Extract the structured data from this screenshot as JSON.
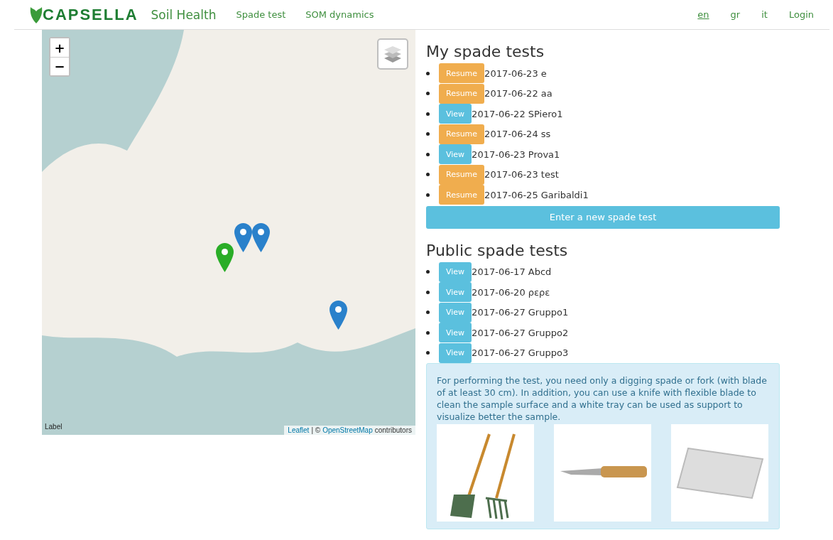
{
  "header": {
    "brand": "CAPSELLA",
    "app_name": "Soil Health",
    "nav": [
      {
        "label": "Spade test"
      },
      {
        "label": "SOM dynamics"
      }
    ],
    "languages": [
      {
        "label": "en",
        "selected": true
      },
      {
        "label": "gr",
        "selected": false
      },
      {
        "label": "it",
        "selected": false
      }
    ],
    "login": "Login"
  },
  "map": {
    "zoom_in": "+",
    "zoom_out": "−",
    "corner_label": "Label",
    "markers": [
      {
        "color": "#2a81cb"
      },
      {
        "color": "#2a81cb"
      },
      {
        "color": "#2aad27"
      },
      {
        "color": "#2a81cb"
      }
    ],
    "attribution": {
      "link_1": "Leaflet",
      "separator": "| ©",
      "link_2": "OpenStreetMap",
      "suffix": "contributors"
    }
  },
  "my_tests": {
    "title": "My spade tests",
    "items": [
      {
        "kind": "resume",
        "button": "Resume",
        "label": "2017-06-23 e"
      },
      {
        "kind": "resume",
        "button": "Resume",
        "label": "2017-06-22 aa"
      },
      {
        "kind": "view",
        "button": "View",
        "label": "2017-06-22 SPiero1"
      },
      {
        "kind": "resume",
        "button": "Resume",
        "label": "2017-06-24 ss"
      },
      {
        "kind": "view",
        "button": "View",
        "label": "2017-06-23 Prova1"
      },
      {
        "kind": "resume",
        "button": "Resume",
        "label": "2017-06-23 test"
      },
      {
        "kind": "resume",
        "button": "Resume",
        "label": "2017-06-25 Garibaldi1"
      }
    ],
    "new_button": "Enter a new spade test"
  },
  "public_tests": {
    "title": "Public spade tests",
    "items": [
      {
        "kind": "view",
        "button": "View",
        "label": "2017-06-17 Abcd"
      },
      {
        "kind": "view",
        "button": "View",
        "label": "2017-06-20 ρερε"
      },
      {
        "kind": "view",
        "button": "View",
        "label": "2017-06-27 Gruppo1"
      },
      {
        "kind": "view",
        "button": "View",
        "label": "2017-06-27 Gruppo2"
      },
      {
        "kind": "view",
        "button": "View",
        "label": "2017-06-27 Gruppo3"
      }
    ]
  },
  "info": {
    "text": "For performing the test, you need only a digging spade or fork (with blade of at least 30 cm). In addition, you can use a knife with flexible blade to clean the sample surface and a white tray can be used as support to visualize better the sample.",
    "pictures": [
      {
        "kind": "spade"
      },
      {
        "kind": "knife"
      },
      {
        "kind": "tray"
      }
    ]
  }
}
